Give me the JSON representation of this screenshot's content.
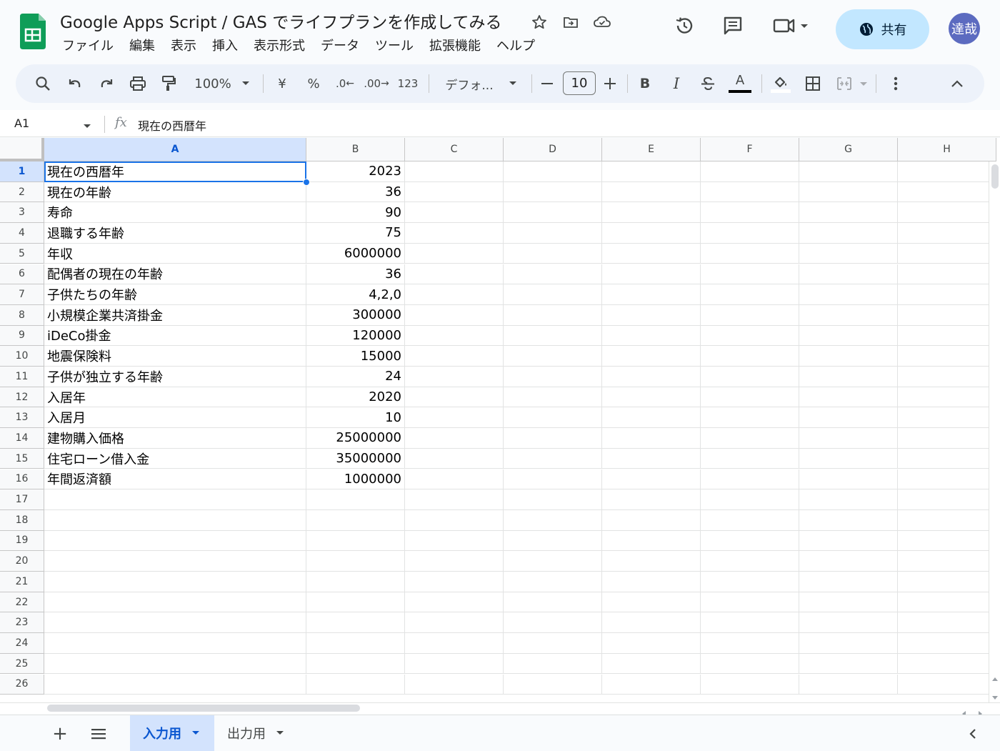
{
  "app": {
    "doc_title": "Google Apps Script / GAS でライフプランを作成してみる",
    "menu": [
      "ファイル",
      "編集",
      "表示",
      "挿入",
      "表示形式",
      "データ",
      "ツール",
      "拡張機能",
      "ヘルプ"
    ],
    "share_label": "共有",
    "avatar_text": "達哉"
  },
  "toolbar": {
    "zoom": "100%",
    "currency": "¥",
    "percent": "%",
    "dec_less": ".0",
    "dec_more": ".00",
    "format_123": "123",
    "font": "デフォ...",
    "font_size": "10",
    "bold": "B",
    "italic": "I",
    "text_color_letter": "A"
  },
  "formula_bar": {
    "name_box": "A1",
    "fx": "fx",
    "value": "現在の西暦年"
  },
  "grid": {
    "columns": [
      "A",
      "B",
      "C",
      "D",
      "E",
      "F",
      "G",
      "H"
    ],
    "selected_column": "A",
    "selected_row": "1",
    "row_numbers": [
      "1",
      "2",
      "3",
      "4",
      "5",
      "6",
      "7",
      "8",
      "9",
      "10",
      "11",
      "12",
      "13",
      "14",
      "15",
      "16",
      "17",
      "18",
      "19",
      "20",
      "21",
      "22",
      "23",
      "24",
      "25",
      "26"
    ],
    "rows": [
      {
        "a": "現在の西暦年",
        "b": "2023"
      },
      {
        "a": "現在の年齢",
        "b": "36"
      },
      {
        "a": "寿命",
        "b": "90"
      },
      {
        "a": "退職する年齢",
        "b": "75"
      },
      {
        "a": "年収",
        "b": "6000000"
      },
      {
        "a": "配偶者の現在の年齢",
        "b": "36"
      },
      {
        "a": "子供たちの年齢",
        "b": "4,2,0"
      },
      {
        "a": "小規模企業共済掛金",
        "b": "300000"
      },
      {
        "a": "iDeCo掛金",
        "b": "120000"
      },
      {
        "a": "地震保険料",
        "b": "15000"
      },
      {
        "a": "子供が独立する年齢",
        "b": "24"
      },
      {
        "a": "入居年",
        "b": "2020"
      },
      {
        "a": "入居月",
        "b": "10"
      },
      {
        "a": "建物購入価格",
        "b": "25000000"
      },
      {
        "a": "住宅ローン借入金",
        "b": "35000000"
      },
      {
        "a": "年間返済額",
        "b": "1000000"
      }
    ]
  },
  "sheets": {
    "add": "+",
    "list": "≡",
    "tabs": [
      "入力用",
      "出力用"
    ],
    "active": "入力用"
  },
  "colors": {
    "accent": "#0b57d0",
    "selection": "#1a73e8",
    "share_bg": "#c2e7ff",
    "avatar_bg": "#5c6bc0",
    "logo_green": "#0f9d58"
  }
}
